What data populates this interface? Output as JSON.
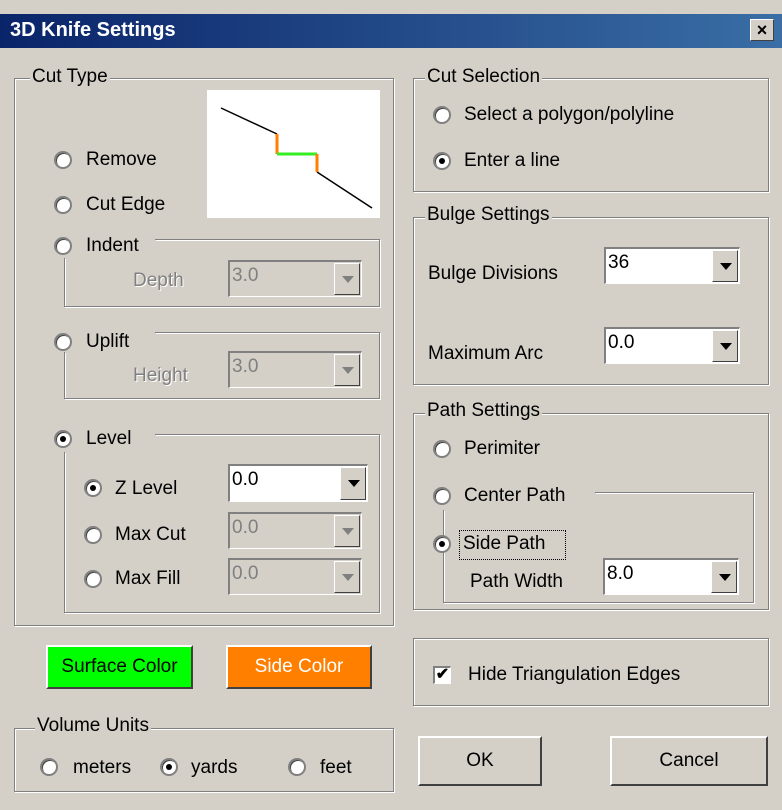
{
  "window": {
    "title": "3D Knife Settings",
    "close_glyph": "×"
  },
  "cut_type": {
    "label": "Cut Type",
    "options": {
      "remove": "Remove",
      "cut_edge": "Cut Edge",
      "indent": "Indent",
      "uplift": "Uplift",
      "level": "Level"
    },
    "selected": "level",
    "indent_depth": {
      "label": "Depth",
      "value": "3.0"
    },
    "uplift_height": {
      "label": "Height",
      "value": "3.0"
    },
    "level_options": {
      "z_level": {
        "label": "Z Level",
        "value": "0.0"
      },
      "max_cut": {
        "label": "Max Cut",
        "value": "0.0"
      },
      "max_fill": {
        "label": "Max Fill",
        "value": "0.0"
      }
    },
    "level_selected": "z_level",
    "preview": {
      "line_color": "#000000",
      "surface_color": "#33ee22",
      "side_color": "#ff7f00"
    }
  },
  "colors": {
    "surface_button": {
      "label": "Surface Color",
      "color": "#00ff00"
    },
    "side_button": {
      "label": "Side Color",
      "color": "#ff7f00"
    }
  },
  "volume_units": {
    "label": "Volume Units",
    "options": {
      "meters": "meters",
      "yards": "yards",
      "feet": "feet"
    },
    "selected": "yards"
  },
  "cut_selection": {
    "label": "Cut Selection",
    "options": {
      "polygon": "Select a polygon/polyline",
      "line": "Enter a line"
    },
    "selected": "line"
  },
  "bulge": {
    "label": "Bulge Settings",
    "divisions": {
      "label": "Bulge Divisions",
      "value": "36"
    },
    "max_arc": {
      "label": "Maximum Arc",
      "value": "0.0"
    }
  },
  "path": {
    "label": "Path Settings",
    "options": {
      "perimiter": "Perimiter",
      "center": "Center Path",
      "side": "Side Path"
    },
    "selected": "side",
    "width": {
      "label": "Path Width",
      "value": "8.0"
    }
  },
  "hide_edges": {
    "label": "Hide Triangulation Edges",
    "checked": true,
    "check_glyph": "✔"
  },
  "buttons": {
    "ok": "OK",
    "cancel": "Cancel"
  }
}
